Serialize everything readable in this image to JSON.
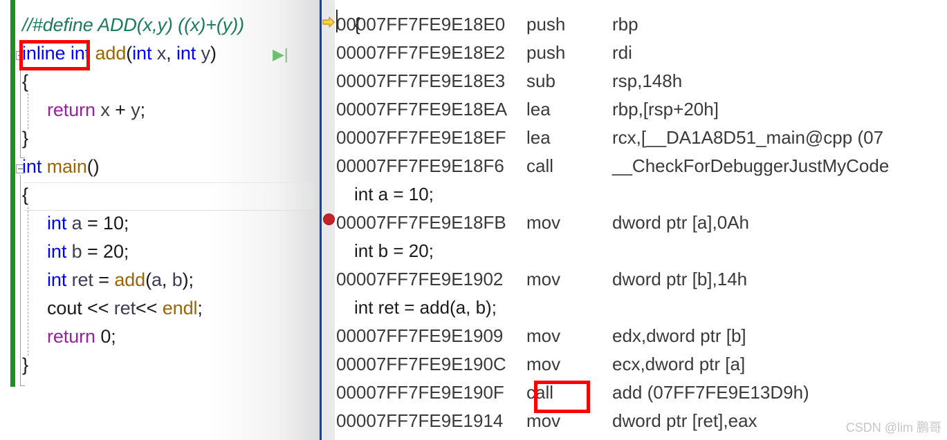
{
  "source_pane": {
    "name": "cpp-source-editor",
    "lines": [
      {
        "indent": 0,
        "segments": [
          {
            "t": "//#define ADD(x,y) ((x)+(y))",
            "c": "comment"
          }
        ]
      },
      {
        "indent": 0,
        "segments": [
          {
            "t": "inline",
            "c": "kw-blue"
          },
          {
            "t": " ",
            "c": "pl"
          },
          {
            "t": "int",
            "c": "kw-blue"
          },
          {
            "t": " ",
            "c": "pl"
          },
          {
            "t": "add",
            "c": "fn-brown"
          },
          {
            "t": "(",
            "c": "pl"
          },
          {
            "t": "int",
            "c": "kw-blue"
          },
          {
            "t": " ",
            "c": "pl"
          },
          {
            "t": "x",
            "c": "id-dark"
          },
          {
            "t": ", ",
            "c": "pl"
          },
          {
            "t": "int",
            "c": "kw-blue"
          },
          {
            "t": " ",
            "c": "pl"
          },
          {
            "t": "y",
            "c": "id-dark"
          },
          {
            "t": ")",
            "c": "pl"
          }
        ]
      },
      {
        "indent": 0,
        "segments": [
          {
            "t": "{",
            "c": "pl"
          }
        ]
      },
      {
        "indent": 1,
        "segments": [
          {
            "t": "return",
            "c": "kw-purple"
          },
          {
            "t": " ",
            "c": "pl"
          },
          {
            "t": "x",
            "c": "id-dark"
          },
          {
            "t": " + ",
            "c": "pl"
          },
          {
            "t": "y",
            "c": "id-dark"
          },
          {
            "t": ";",
            "c": "pl"
          }
        ]
      },
      {
        "indent": 0,
        "segments": [
          {
            "t": "}",
            "c": "pl"
          }
        ]
      },
      {
        "indent": 0,
        "segments": [
          {
            "t": "int",
            "c": "kw-blue"
          },
          {
            "t": " ",
            "c": "pl"
          },
          {
            "t": "main",
            "c": "fn-brown"
          },
          {
            "t": "()",
            "c": "pl"
          }
        ]
      },
      {
        "indent": 0,
        "segments": [
          {
            "t": "{",
            "c": "pl"
          }
        ]
      },
      {
        "indent": 1,
        "segments": [
          {
            "t": "int",
            "c": "kw-blue"
          },
          {
            "t": " ",
            "c": "pl"
          },
          {
            "t": "a",
            "c": "id-dark"
          },
          {
            "t": " = ",
            "c": "pl"
          },
          {
            "t": "10",
            "c": "pl"
          },
          {
            "t": ";",
            "c": "pl"
          }
        ]
      },
      {
        "indent": 1,
        "segments": [
          {
            "t": "int",
            "c": "kw-blue"
          },
          {
            "t": " ",
            "c": "pl"
          },
          {
            "t": "b",
            "c": "id-dark"
          },
          {
            "t": " = ",
            "c": "pl"
          },
          {
            "t": "20",
            "c": "pl"
          },
          {
            "t": ";",
            "c": "pl"
          }
        ]
      },
      {
        "indent": 1,
        "segments": [
          {
            "t": "int",
            "c": "kw-blue"
          },
          {
            "t": " ",
            "c": "pl"
          },
          {
            "t": "ret",
            "c": "id-dark"
          },
          {
            "t": " = ",
            "c": "pl"
          },
          {
            "t": "add",
            "c": "fn-brown"
          },
          {
            "t": "(",
            "c": "pl"
          },
          {
            "t": "a",
            "c": "id-dark"
          },
          {
            "t": ", ",
            "c": "pl"
          },
          {
            "t": "b",
            "c": "id-dark"
          },
          {
            "t": ");",
            "c": "pl"
          }
        ]
      },
      {
        "indent": 1,
        "segments": [
          {
            "t": "cout",
            "c": "pl"
          },
          {
            "t": " << ",
            "c": "pl"
          },
          {
            "t": "ret",
            "c": "id-dark"
          },
          {
            "t": "<< ",
            "c": "pl"
          },
          {
            "t": "endl",
            "c": "fn-brown"
          },
          {
            "t": ";",
            "c": "pl"
          }
        ]
      },
      {
        "indent": 1,
        "segments": [
          {
            "t": "return",
            "c": "kw-purple"
          },
          {
            "t": " ",
            "c": "pl"
          },
          {
            "t": "0",
            "c": "pl"
          },
          {
            "t": ";",
            "c": "pl"
          }
        ]
      },
      {
        "indent": 0,
        "segments": [
          {
            "t": "}",
            "c": "pl"
          }
        ]
      }
    ],
    "run_marker_glyph": "▶|"
  },
  "disassembly_pane": {
    "name": "disassembly-view",
    "top_partial_line": "{",
    "rows": [
      {
        "kind": "asm",
        "marker": "exec-arrow",
        "address": "00007FF7FE9E18E0",
        "mnemonic": "push",
        "operands": "rbp"
      },
      {
        "kind": "asm",
        "marker": "",
        "address": "00007FF7FE9E18E2",
        "mnemonic": "push",
        "operands": "rdi"
      },
      {
        "kind": "asm",
        "marker": "",
        "address": "00007FF7FE9E18E3",
        "mnemonic": "sub",
        "operands": "rsp,148h"
      },
      {
        "kind": "asm",
        "marker": "",
        "address": "00007FF7FE9E18EA",
        "mnemonic": "lea",
        "operands": "rbp,[rsp+20h]"
      },
      {
        "kind": "asm",
        "marker": "",
        "address": "00007FF7FE9E18EF",
        "mnemonic": "lea",
        "operands": "rcx,[__DA1A8D51_main@cpp (07"
      },
      {
        "kind": "asm",
        "marker": "",
        "address": "00007FF7FE9E18F6",
        "mnemonic": "call",
        "operands": "__CheckForDebuggerJustMyCode"
      },
      {
        "kind": "src",
        "marker": "",
        "text": "int a = 10;"
      },
      {
        "kind": "asm",
        "marker": "breakpoint",
        "address": "00007FF7FE9E18FB",
        "mnemonic": "mov",
        "operands": "dword ptr [a],0Ah"
      },
      {
        "kind": "src",
        "marker": "",
        "text": "int b = 20;"
      },
      {
        "kind": "asm",
        "marker": "",
        "address": "00007FF7FE9E1902",
        "mnemonic": "mov",
        "operands": "dword ptr [b],14h"
      },
      {
        "kind": "src",
        "marker": "",
        "text": "int ret = add(a, b);"
      },
      {
        "kind": "asm",
        "marker": "",
        "address": "00007FF7FE9E1909",
        "mnemonic": "mov",
        "operands": "edx,dword ptr [b]"
      },
      {
        "kind": "asm",
        "marker": "",
        "address": "00007FF7FE9E190C",
        "mnemonic": "mov",
        "operands": "ecx,dword ptr [a]"
      },
      {
        "kind": "asm",
        "marker": "",
        "address": "00007FF7FE9E190F",
        "mnemonic": "call",
        "operands": "add (07FF7FE9E13D9h)"
      },
      {
        "kind": "asm",
        "marker": "",
        "address": "00007FF7FE9E1914",
        "mnemonic": "mov",
        "operands": "dword ptr [ret],eax"
      }
    ]
  },
  "annotations": {
    "inline_keyword_box": {
      "label": "inline"
    },
    "call_instruction_box": {
      "label": "call"
    }
  },
  "watermark": {
    "text": "CSDN @lim 鹏哥"
  },
  "colors": {
    "annotation_red": "#fe0000",
    "divider_blue": "#1f3f87",
    "change_bar_green": "#1f9021",
    "breakpoint_red": "#c5232b",
    "exec_arrow_yellow": "#ffd24a",
    "gutter_gray": "#e9e9ec",
    "keyword_blue": "#0000ff",
    "keyword_purple": "#9b1fa0",
    "comment_green": "#1a7a5a",
    "function_brown": "#9c6500",
    "watermark_gray": "#c6c6c6"
  }
}
